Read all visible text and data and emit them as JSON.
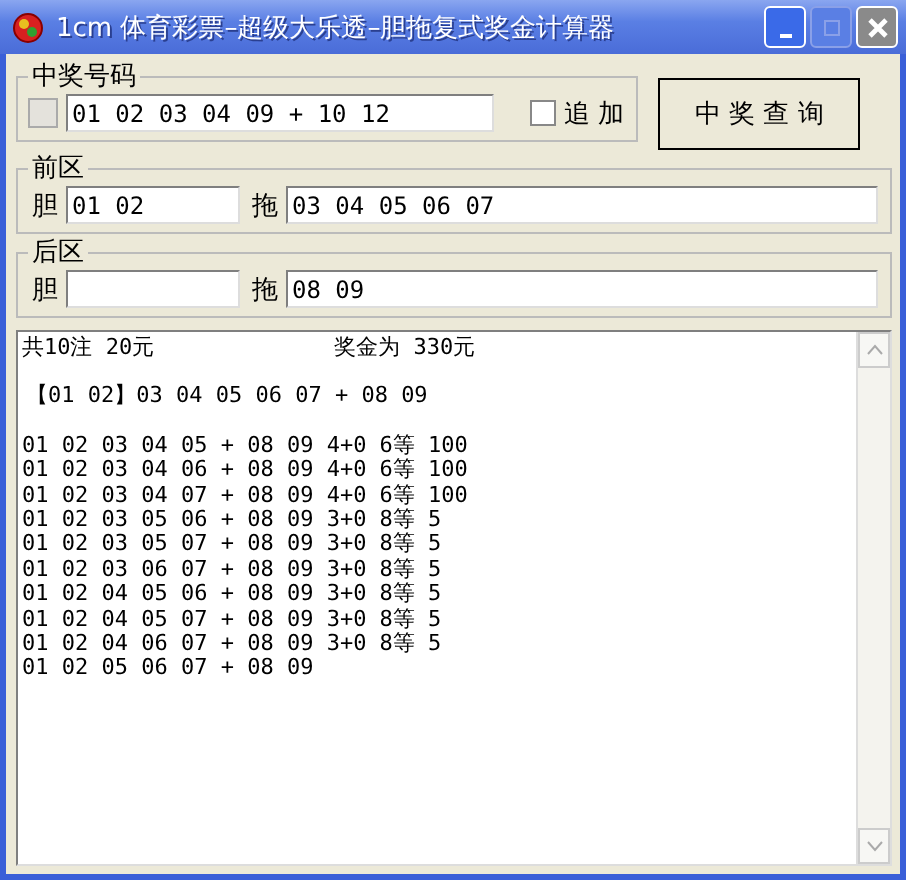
{
  "window": {
    "title": "1cm 体育彩票–超级大乐透–胆拖复式奖金计算器"
  },
  "winning": {
    "legend": "中奖号码",
    "value": "01 02 03 04 09 + 10 12",
    "add_on": {
      "label": "追 加",
      "checked": false
    }
  },
  "query_button": "中 奖 查 询",
  "front": {
    "legend": "前区",
    "banker_label": "胆",
    "banker": "01 02",
    "drag_label": "拖",
    "drag": "03 04 05 06 07"
  },
  "back": {
    "legend": "后区",
    "banker_label": "胆",
    "drag_label": "拖",
    "drag": "08 09"
  },
  "result": {
    "count": "共10注 20元",
    "prize": "奖金为 330元",
    "pattern": "【01 02】03 04 05 06 07 + 08 09",
    "rows": [
      "01 02 03 04 05 + 08 09 4+0 6等 100",
      "01 02 03 04 06 + 08 09 4+0 6等 100",
      "01 02 03 04 07 + 08 09 4+0 6等 100",
      "01 02 03 05 06 + 08 09 3+0 8等 5",
      "01 02 03 05 07 + 08 09 3+0 8等 5",
      "01 02 03 06 07 + 08 09 3+0 8等 5",
      "01 02 04 05 06 + 08 09 3+0 8等 5",
      "01 02 04 05 07 + 08 09 3+0 8等 5",
      "01 02 04 06 07 + 08 09 3+0 8等 5",
      "01 02 05 06 07 + 08 09"
    ]
  }
}
